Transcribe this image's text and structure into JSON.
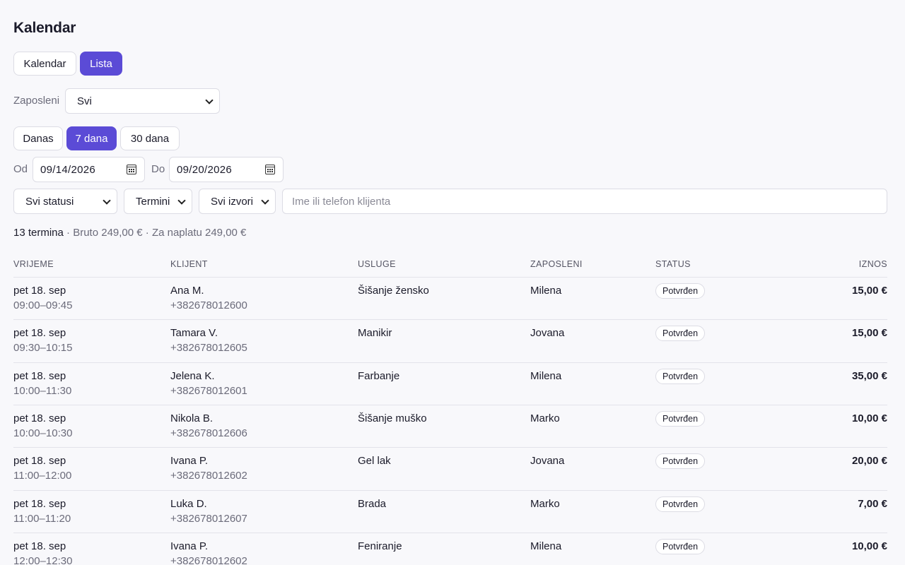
{
  "page_title": "Kalendar",
  "view_toggle": [
    {
      "label": "Kalendar",
      "active": false
    },
    {
      "label": "Lista",
      "active": true
    }
  ],
  "employee_filter": {
    "label": "Zaposleni",
    "selected": "Svi"
  },
  "range_buttons": [
    {
      "label": "Danas",
      "active": false
    },
    {
      "label": "7 dana",
      "active": true
    },
    {
      "label": "30 dana",
      "active": false
    }
  ],
  "date_from": {
    "label": "Od",
    "value": "09/14/2026"
  },
  "date_to": {
    "label": "Do",
    "value": "09/20/2026"
  },
  "filters": {
    "status": "Svi statusi",
    "type": "Termini",
    "source": "Svi izvori",
    "search_placeholder": "Ime ili telefon klijenta"
  },
  "summary": {
    "count": "13 termina",
    "rest": " · Bruto 249,00 € · Za naplatu 249,00 €"
  },
  "table": {
    "columns": [
      "VRIJEME",
      "KLIJENT",
      "USLUGE",
      "ZAPOSLENI",
      "STATUS",
      "IZNOS"
    ],
    "rows": [
      {
        "date": "pet 18. sep",
        "time": "09:00–09:45",
        "client": "Ana M.",
        "phone": "+382678012600",
        "service": "Šišanje žensko",
        "employee": "Milena",
        "status": "Potvrđen",
        "amount": "15,00 €"
      },
      {
        "date": "pet 18. sep",
        "time": "09:30–10:15",
        "client": "Tamara V.",
        "phone": "+382678012605",
        "service": "Manikir",
        "employee": "Jovana",
        "status": "Potvrđen",
        "amount": "15,00 €"
      },
      {
        "date": "pet 18. sep",
        "time": "10:00–11:30",
        "client": "Jelena K.",
        "phone": "+382678012601",
        "service": "Farbanje",
        "employee": "Milena",
        "status": "Potvrđen",
        "amount": "35,00 €"
      },
      {
        "date": "pet 18. sep",
        "time": "10:00–10:30",
        "client": "Nikola B.",
        "phone": "+382678012606",
        "service": "Šišanje muško",
        "employee": "Marko",
        "status": "Potvrđen",
        "amount": "10,00 €"
      },
      {
        "date": "pet 18. sep",
        "time": "11:00–12:00",
        "client": "Ivana P.",
        "phone": "+382678012602",
        "service": "Gel lak",
        "employee": "Jovana",
        "status": "Potvrđen",
        "amount": "20,00 €"
      },
      {
        "date": "pet 18. sep",
        "time": "11:00–11:20",
        "client": "Luka D.",
        "phone": "+382678012607",
        "service": "Brada",
        "employee": "Marko",
        "status": "Potvrđen",
        "amount": "7,00 €"
      },
      {
        "date": "pet 18. sep",
        "time": "12:00–12:30",
        "client": "Ivana P.",
        "phone": "+382678012602",
        "service": "Feniranje",
        "employee": "Milena",
        "status": "Potvrđen",
        "amount": "10,00 €"
      }
    ]
  },
  "colors": {
    "accent": "#5b4bd6",
    "background": "#f8f8fb",
    "border": "#dcdce4"
  },
  "icons": {
    "date_picker": "calendar-icon",
    "select": "chevron-down-icon"
  }
}
